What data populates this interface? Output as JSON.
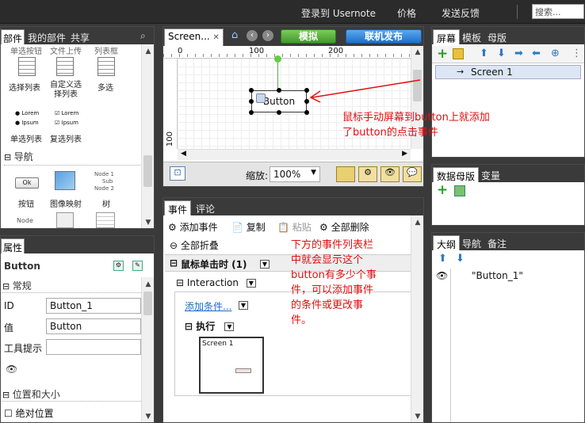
{
  "topbar": {
    "login": "登录到 Usernote",
    "price": "价格",
    "feedback": "发送反馈",
    "search_placeholder": "搜索..."
  },
  "widgets": {
    "tabs": [
      "部件",
      "我的部件",
      "共享"
    ],
    "cut_top": [
      "单选按钮",
      "文件上传",
      "列表框"
    ],
    "row1": [
      "选择列表",
      "自定义选择列表",
      "多选"
    ],
    "row2_items": {
      "lorem": "Lorem",
      "ipsum": "Ipsum"
    },
    "row2": [
      "单选列表",
      "复选列表"
    ],
    "section_nav": "导航",
    "row3_ok": "Ok",
    "row3": [
      "按钮",
      "图像映射",
      "树"
    ],
    "tree_items": [
      "Node 1",
      "Sub",
      "Node 2"
    ],
    "row4_node": "Node"
  },
  "props": {
    "tab": "属性",
    "element": "Button",
    "section_general": "常规",
    "id_label": "ID",
    "id_value": "Button_1",
    "value_label": "值",
    "value_value": "Button",
    "tooltip_label": "工具提示",
    "tooltip_value": "",
    "section_pos": "位置和大小",
    "absolute_pos": "绝对位置"
  },
  "canvas": {
    "tab": "Screen...",
    "preview_btn": "模拟",
    "publish_btn": "联机发布",
    "ruler_marks": [
      "0",
      "100",
      "200"
    ],
    "ruler_v": "100",
    "button_text": "Button",
    "zoom_label": "缩放:",
    "zoom_value": "100%"
  },
  "events": {
    "tabs": [
      "事件",
      "评论"
    ],
    "add_event": "添加事件",
    "copy": "复制",
    "paste": "粘贴",
    "delete_all": "全部删除",
    "collapse_all": "全部折叠",
    "event_name": "鼠标单击时 (1)",
    "interaction": "Interaction",
    "add_condition": "添加条件...",
    "execute": "执行",
    "thumb_screen": "Screen 1"
  },
  "screens": {
    "tabs": [
      "屏幕",
      "模板",
      "母版"
    ],
    "item": "Screen 1"
  },
  "data_masters": {
    "tabs": [
      "数据母版",
      "变量"
    ]
  },
  "outline": {
    "tabs": [
      "大纲",
      "导航",
      "备注"
    ],
    "item": "\"Button_1\""
  },
  "annotations": {
    "note1_line1": "鼠标手动屏幕到button上就添加",
    "note1_line2": "了button的点击事件",
    "note2_line1": "下方的事件列表栏",
    "note2_line2": "中就会显示这个",
    "note2_line3": "button有多少个事",
    "note2_line4": "件，可以添加事件",
    "note2_line5": "的条件或更改事",
    "note2_line6": "件。"
  },
  "colors": {
    "annotation": "#e01010",
    "accent_green": "#3f9a2a",
    "accent_blue": "#1f6fc8"
  }
}
